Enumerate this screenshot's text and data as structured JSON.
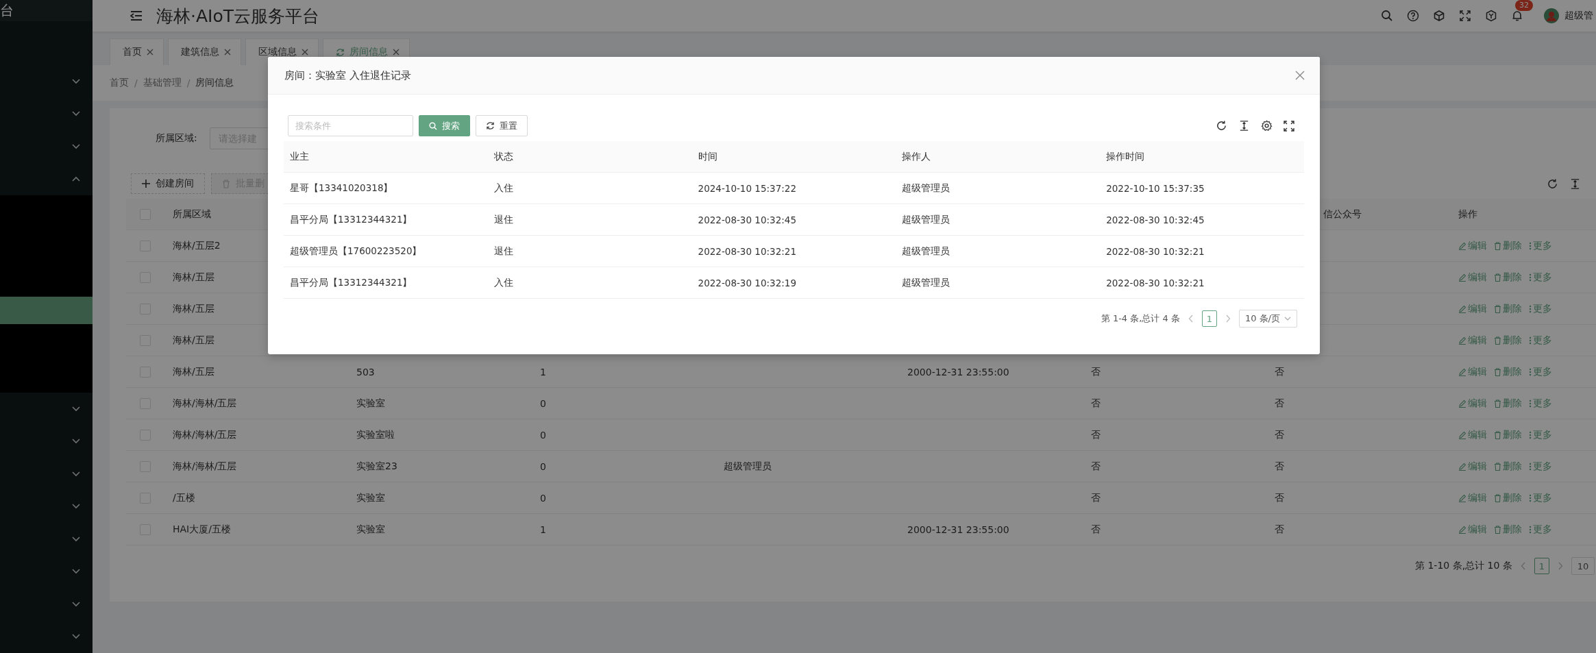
{
  "sidebar": {
    "logo_text": "台",
    "items": [
      {
        "expanded": false
      },
      {
        "expanded": false
      },
      {
        "expanded": false
      },
      {
        "expanded": true,
        "children": [
          {
            "selected": false
          },
          {
            "selected": false
          },
          {
            "selected": false
          },
          {
            "selected": true
          },
          {
            "selected": false
          },
          {
            "selected": false
          }
        ]
      },
      {
        "expanded": false
      },
      {
        "expanded": false
      },
      {
        "expanded": false
      },
      {
        "expanded": false
      },
      {
        "expanded": false
      },
      {
        "expanded": false
      },
      {
        "expanded": false
      },
      {
        "expanded": false
      }
    ]
  },
  "header": {
    "title": "海林·AIoT云服务平台",
    "notification_count": "32",
    "user_name": "超级管"
  },
  "tabs": [
    {
      "label": "首页",
      "selected": false
    },
    {
      "label": "建筑信息",
      "selected": false
    },
    {
      "label": "区域信息",
      "selected": false
    },
    {
      "label": "房间信息",
      "selected": true
    }
  ],
  "breadcrumb": {
    "separator": "/",
    "items": [
      "首页",
      "基础管理",
      "房间信息"
    ]
  },
  "filter": {
    "label": "所属区域:",
    "placeholder": "请选择建"
  },
  "toolbar_buttons": [
    {
      "kind": "create",
      "label": "创建房间",
      "disabled": false
    },
    {
      "kind": "delete",
      "label": "批量删",
      "disabled": true
    }
  ],
  "table": {
    "header_checked": false,
    "column_headers": {
      "area": "所属区域",
      "wechat": "信公众号",
      "actions": "操作"
    },
    "rows": [
      {
        "checked": false,
        "area": "海林/五层2",
        "actions": [
          "编辑",
          "删除",
          "更多"
        ]
      },
      {
        "checked": false,
        "area": "海林/五层",
        "actions": [
          "编辑",
          "删除",
          "更多"
        ]
      },
      {
        "checked": false,
        "area": "海林/五层",
        "actions": [
          "编辑",
          "删除",
          "更多"
        ]
      },
      {
        "checked": false,
        "area": "海林/五层",
        "actions": [
          "编辑",
          "删除",
          "更多"
        ]
      },
      {
        "checked": false,
        "area": "海林/五层",
        "column_2": "503",
        "column_3": "1",
        "column_5": "2000-12-31 23:55:00",
        "column_6": "否",
        "wechat": "否",
        "actions": [
          "编辑",
          "删除",
          "更多"
        ]
      },
      {
        "checked": false,
        "area": "海林/海林/五层",
        "column_2": "实验室",
        "column_3": "0",
        "column_6": "否",
        "wechat": "否",
        "actions": [
          "编辑",
          "删除",
          "更多"
        ]
      },
      {
        "checked": false,
        "area": "海林/海林/五层",
        "column_2": "实验室啦",
        "column_3": "0",
        "column_6": "否",
        "wechat": "否",
        "actions": [
          "编辑",
          "删除",
          "更多"
        ]
      },
      {
        "checked": false,
        "area": "海林/海林/五层",
        "column_2": "实验室23",
        "column_3": "0",
        "column_4": "超级管理员",
        "column_6": "否",
        "wechat": "否",
        "actions": [
          "编辑",
          "删除",
          "更多"
        ]
      },
      {
        "checked": false,
        "area": "/五楼",
        "column_2": "实验室",
        "column_3": "0",
        "column_6": "否",
        "wechat": "否",
        "actions": [
          "编辑",
          "删除",
          "更多"
        ]
      },
      {
        "checked": false,
        "area": "HAI大厦/五楼",
        "column_2": "实验室",
        "column_3": "1",
        "column_5": "2000-12-31 23:55:00",
        "column_6": "否",
        "wechat": "否",
        "actions": [
          "编辑",
          "删除",
          "更多"
        ]
      }
    ]
  },
  "pagination": {
    "summary": "第 1-10 条,总计 10 条",
    "pages": [
      {
        "label": "1",
        "selected": true
      }
    ],
    "page_size": "10"
  },
  "modal": {
    "title": "房间：实验室 入住退住记录",
    "search": {
      "placeholder": "搜索条件"
    },
    "buttons": [
      {
        "kind": "primary",
        "label": "搜索"
      },
      {
        "kind": "reset",
        "label": "重置"
      }
    ],
    "columns": [
      "业主",
      "状态",
      "时间",
      "操作人",
      "操作时间"
    ],
    "rows": [
      [
        "星哥【13341020318】",
        "入住",
        "2024-10-10 15:37:22",
        "超级管理员",
        "2022-10-10 15:37:35"
      ],
      [
        "昌平分局【13312344321】",
        "退住",
        "2022-08-30 10:32:45",
        "超级管理员",
        "2022-08-30 10:32:45"
      ],
      [
        "超级管理员【17600223520】",
        "退住",
        "2022-08-30 10:32:21",
        "超级管理员",
        "2022-08-30 10:32:21"
      ],
      [
        "昌平分局【13312344321】",
        "入住",
        "2022-08-30 10:32:19",
        "超级管理员",
        "2022-08-30 10:32:21"
      ]
    ],
    "pagination": {
      "summary": "第 1-4 条,总计 4 条",
      "pages": [
        {
          "label": "1",
          "selected": true
        }
      ],
      "page_size": "10 条/页"
    }
  }
}
